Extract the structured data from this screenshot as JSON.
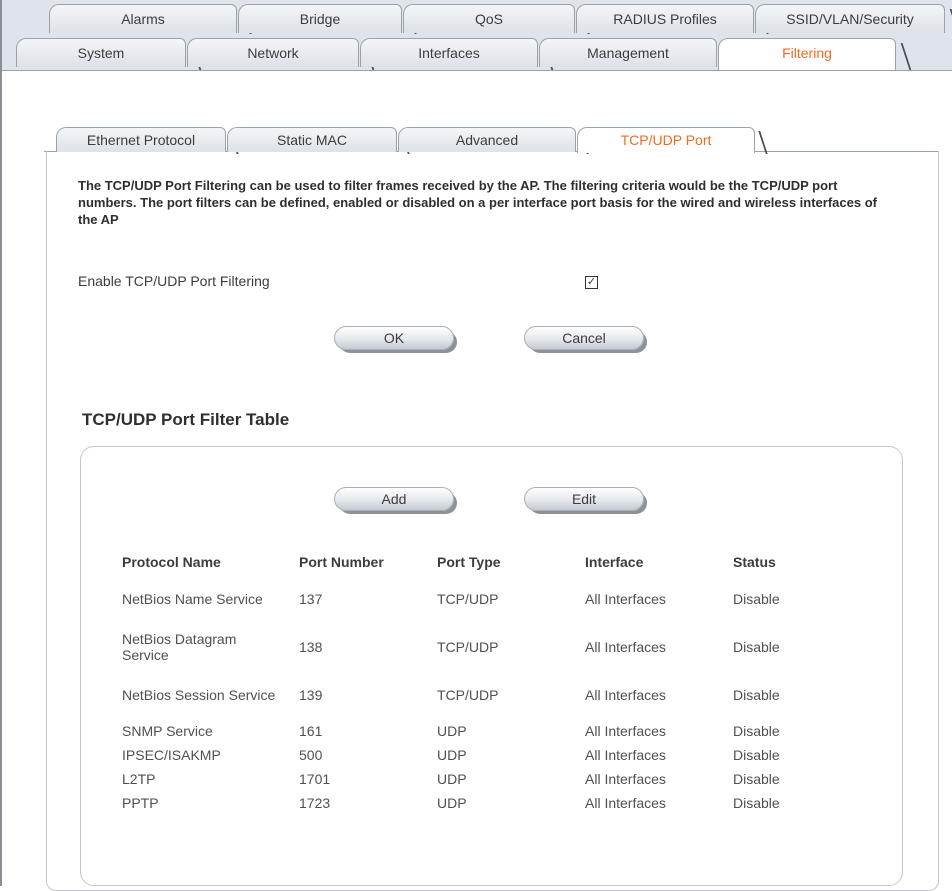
{
  "top_tabs_row1": [
    "Alarms",
    "Bridge",
    "QoS",
    "RADIUS Profiles",
    "SSID/VLAN/Security"
  ],
  "top_tabs_row2": [
    "System",
    "Network",
    "Interfaces",
    "Management",
    "Filtering"
  ],
  "active_top_tab": "Filtering",
  "sub_tabs": [
    "Ethernet Protocol",
    "Static MAC",
    "Advanced",
    "TCP/UDP Port"
  ],
  "active_sub_tab": "TCP/UDP Port",
  "description": "The TCP/UDP Port Filtering can be used to filter frames received by the AP. The filtering criteria would be the TCP/UDP port numbers. The port filters can be defined, enabled or disabled on a per interface port basis for the wired and wireless interfaces of the AP",
  "enable": {
    "label": "Enable TCP/UDP Port Filtering",
    "checked": true,
    "check_glyph": "✓"
  },
  "buttons": {
    "ok": "OK",
    "cancel": "Cancel",
    "add": "Add",
    "edit": "Edit"
  },
  "table": {
    "title": "TCP/UDP Port Filter Table",
    "headers": [
      "Protocol Name",
      "Port Number",
      "Port Type",
      "Interface",
      "Status"
    ],
    "rows": [
      [
        "NetBios Name Service",
        "137",
        "TCP/UDP",
        "All Interfaces",
        "Disable"
      ],
      [
        "NetBios Datagram Service",
        "138",
        "TCP/UDP",
        "All Interfaces",
        "Disable"
      ],
      [
        "NetBios Session Service",
        "139",
        "TCP/UDP",
        "All Interfaces",
        "Disable"
      ],
      [
        "SNMP Service",
        "161",
        "UDP",
        "All Interfaces",
        "Disable"
      ],
      [
        "IPSEC/ISAKMP",
        "500",
        "UDP",
        "All Interfaces",
        "Disable"
      ],
      [
        "L2TP",
        "1701",
        "UDP",
        "All Interfaces",
        "Disable"
      ],
      [
        "PPTP",
        "1723",
        "UDP",
        "All Interfaces",
        "Disable"
      ]
    ]
  },
  "colors": {
    "accent": "#f26b1d",
    "tab_bg": "#dfe4ea",
    "text": "#3c3c3c"
  }
}
